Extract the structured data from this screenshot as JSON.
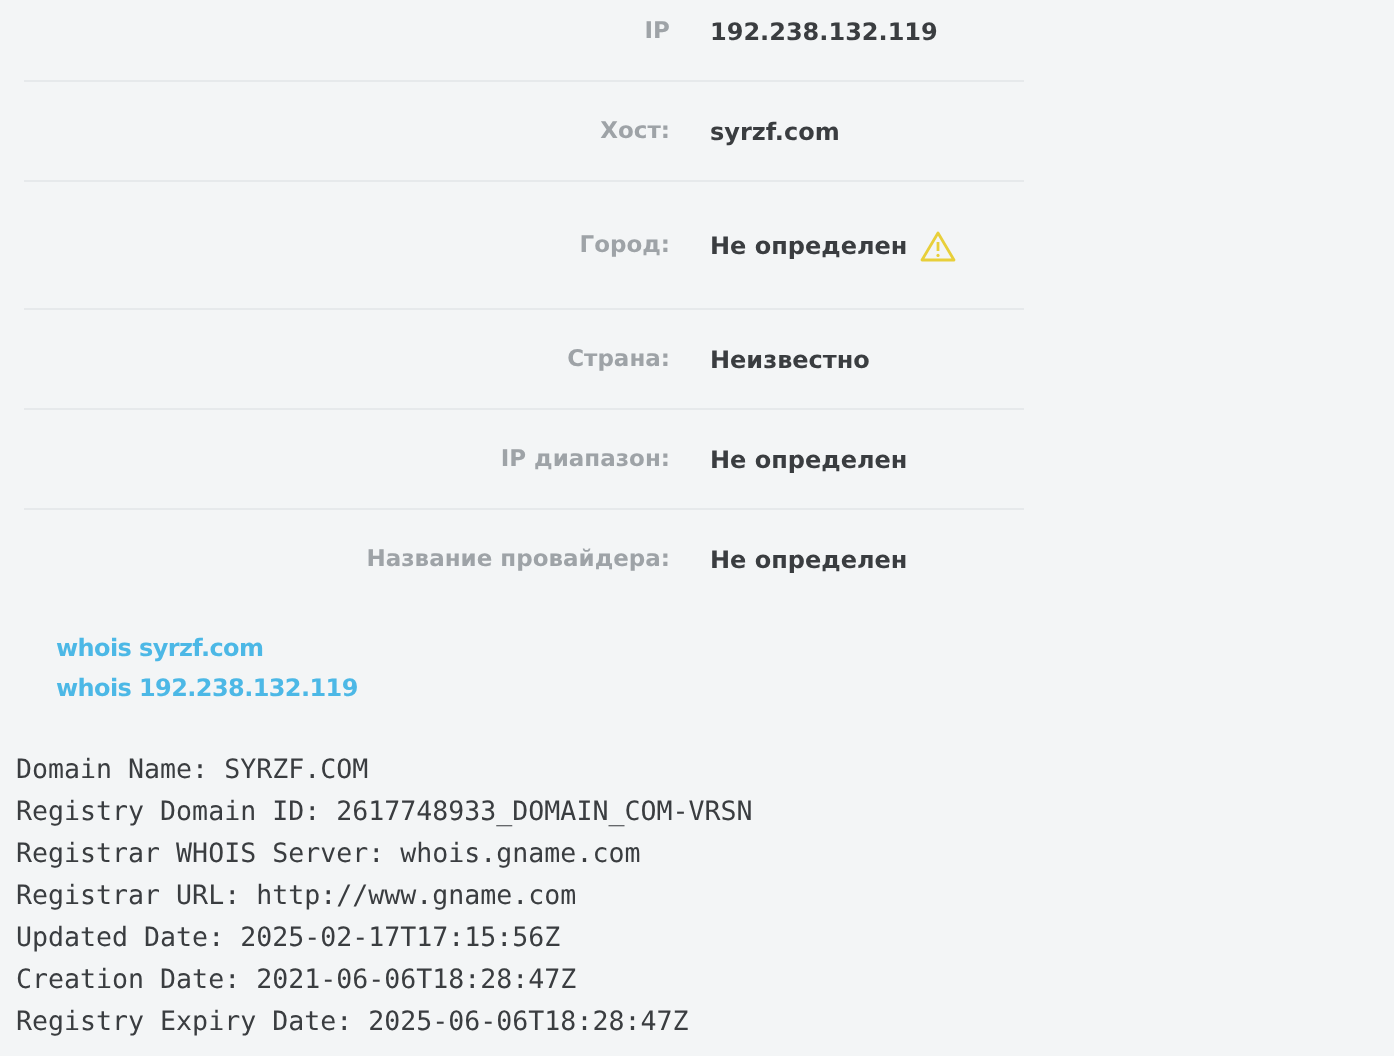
{
  "info_rows": [
    {
      "label": "IP",
      "value": "192.238.132.119",
      "warning": false
    },
    {
      "label": "Хост:",
      "value": "syrzf.com",
      "warning": false
    },
    {
      "label": "Город:",
      "value": "Не определен",
      "warning": true
    },
    {
      "label": "Страна:",
      "value": "Неизвестно",
      "warning": false
    },
    {
      "label": "IP диапазон:",
      "value": "Не определен",
      "warning": false
    },
    {
      "label": "Название провайдера:",
      "value": "Не определен",
      "warning": false
    }
  ],
  "links": [
    "whois syrzf.com",
    "whois 192.238.132.119"
  ],
  "whois_lines": [
    "Domain Name: SYRZF.COM",
    "Registry Domain ID: 2617748933_DOMAIN_COM-VRSN",
    "Registrar WHOIS Server: whois.gname.com",
    "Registrar URL: http://www.gname.com",
    "Updated Date: 2025-02-17T17:15:56Z",
    "Creation Date: 2021-06-06T18:28:47Z",
    "Registry Expiry Date: 2025-06-06T18:28:47Z"
  ]
}
